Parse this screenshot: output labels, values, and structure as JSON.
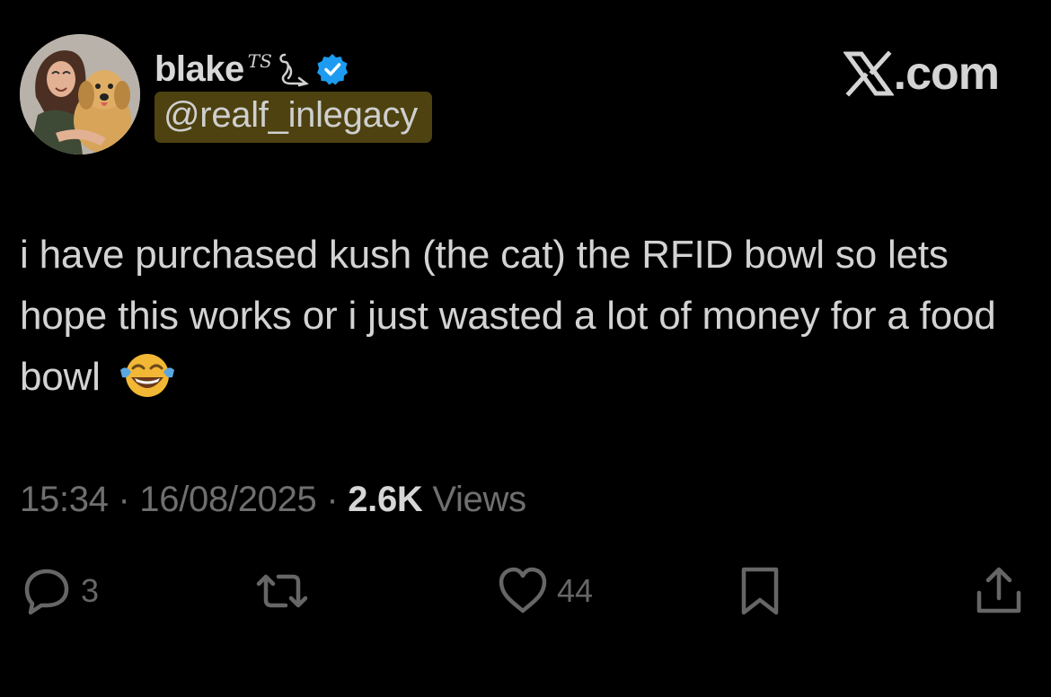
{
  "user": {
    "display_name": "blake",
    "name_decoration": "TS",
    "handle": "@realf_inlegacy",
    "verified": true,
    "avatar_icon": "avatar-woman-with-dog",
    "name_emoji_icon": "snake-emoji-icon",
    "verified_color": "#1d9bf0"
  },
  "brand": {
    "label": ".com"
  },
  "tweet": {
    "text": "i have purchased kush (the cat) the RFID bowl so lets hope this works or i just wasted a lot of money for a food bowl",
    "emoji": "tears-of-joy-emoji"
  },
  "meta": {
    "time": "15:34",
    "date": "16/08/2025",
    "views_count": "2.6K",
    "views_label": "Views",
    "separator": "·"
  },
  "actions": {
    "replies": "3",
    "likes": "44"
  },
  "colors": {
    "background": "#000000",
    "handle_highlight": "#4d4210",
    "text": "#d3d3d3",
    "muted": "#6f6f6f"
  }
}
